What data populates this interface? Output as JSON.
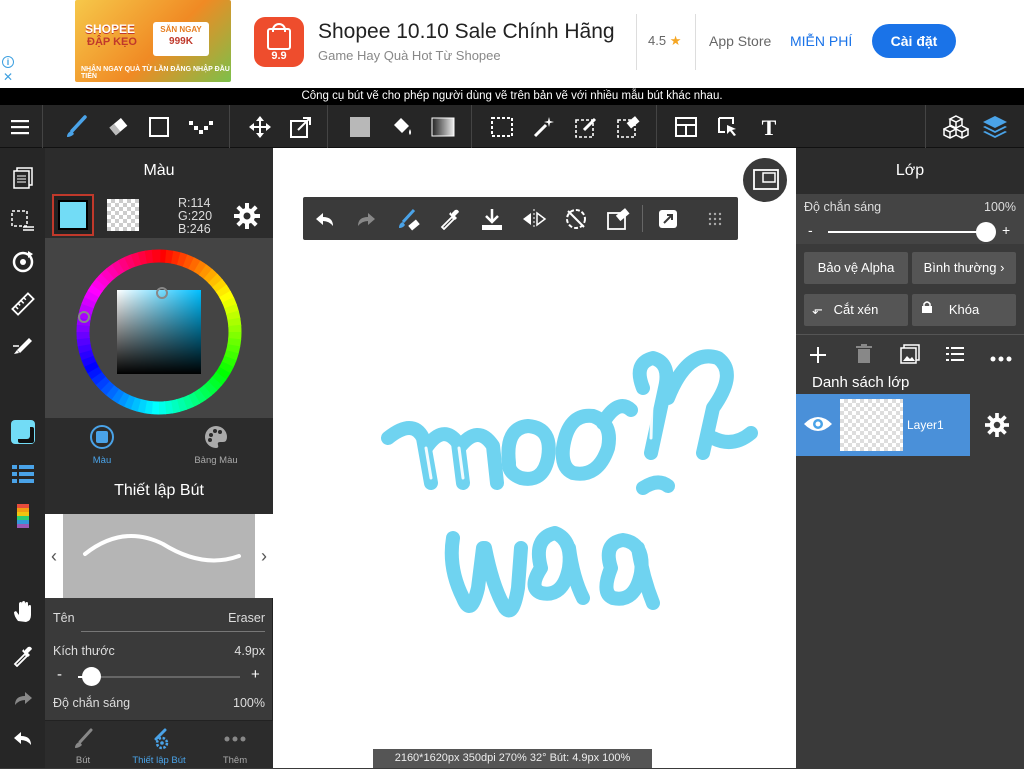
{
  "ad": {
    "banner_title": "SHOPEE",
    "banner_subtitle": "ĐẬP KẸO",
    "banner_button": "SĂN NGAY",
    "banner_prize": "999K",
    "banner_footer": "NHẬN NGAY QUÀ TỪ LẦN ĐĂNG NHẬP ĐẦU TIÊN",
    "app_icon_text": "9.9",
    "title": "Shopee 10.10 Sale Chính Hãng",
    "subtitle": "Game Hay Quà Hot Từ Shopee",
    "rating": "4.5",
    "store": "App Store",
    "price": "MIỄN PHÍ",
    "install": "Cài đặt"
  },
  "hint": "Công cụ bút vẽ cho phép người dùng vẽ trên bản vẽ với nhiều mẫu bút khác nhau.",
  "color_panel": {
    "title": "Màu",
    "r": "R:114",
    "g": "G:220",
    "b": "B:246",
    "tab_color": "Màu",
    "tab_palette": "Bảng Màu",
    "current_color": "#72dcf6"
  },
  "brush_panel": {
    "title": "Thiết lập Bút",
    "name_label": "Tên",
    "name_value": "Eraser",
    "size_label": "Kích thước",
    "size_value": "4.9px",
    "size_fraction": 0.08,
    "minus": "-",
    "plus": "+",
    "opacity_label": "Độ chắn sáng",
    "opacity_value": "100%"
  },
  "bottom_tabs": {
    "brush": "Bút",
    "brush_settings": "Thiết lập Bút",
    "more": "Thêm"
  },
  "canvas": {
    "status": "2160*1620px 350dpi 270% 32° Bút: 4.9px 100%",
    "stroke_color": "#6fd3f0"
  },
  "layer_panel": {
    "title": "Lớp",
    "opacity_label": "Độ chắn sáng",
    "opacity_value": "100%",
    "opacity_fraction": 1.0,
    "minus": "-",
    "plus": "+",
    "protect_alpha": "Bảo vệ Alpha",
    "blend_mode": "Bình thường",
    "clipping": "Cắt xén",
    "lock": "Khóa",
    "list_title": "Danh sách lớp",
    "layers": [
      {
        "name": "Layer1"
      }
    ]
  }
}
